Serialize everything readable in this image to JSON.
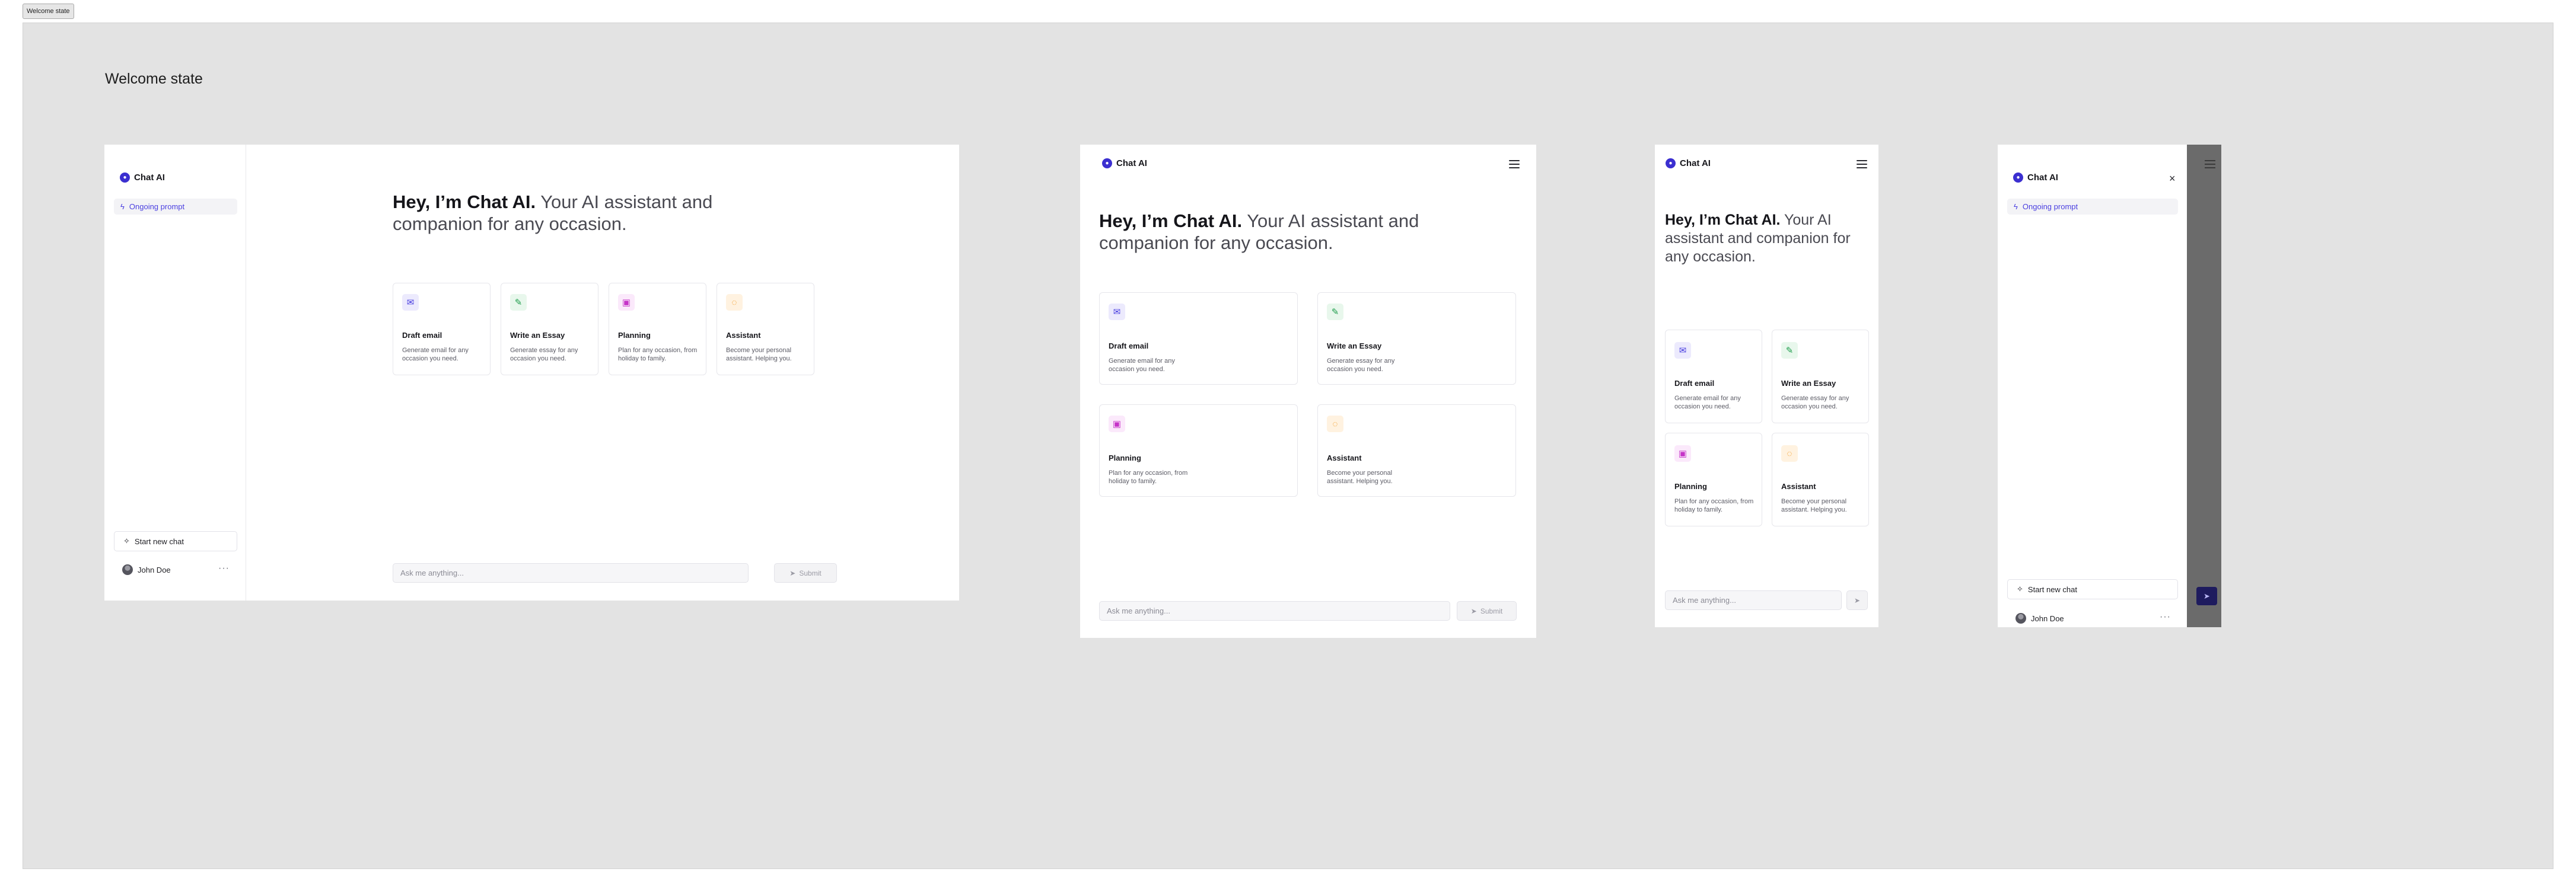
{
  "tag_label": "Welcome state",
  "section_title": "Welcome state",
  "app": {
    "brand": "Chat AI",
    "brand_icon": "chat-bubble-icon",
    "prompt_item": "Ongoing prompt",
    "new_chat": "Start new chat",
    "user_name": "John Doe",
    "more": "···"
  },
  "hero": {
    "bold": "Hey, I’m Chat AI.",
    "rest": " Your AI assistant and companion for any occasion."
  },
  "cards": [
    {
      "icon": "envelope-icon",
      "title": "Draft email",
      "desc": "Generate email for any occasion you need."
    },
    {
      "icon": "pencil-icon",
      "title": "Write an Essay",
      "desc": "Generate essay for any occasion you need."
    },
    {
      "icon": "calendar-icon",
      "title": "Planning",
      "desc": "Plan for any occasion, from holiday to family."
    },
    {
      "icon": "chat-icon",
      "title": "Assistant",
      "desc": "Become your personal assistant. Helping you."
    }
  ],
  "composer": {
    "placeholder": "Ask me anything...",
    "submit": "Submit"
  },
  "colors": {
    "accent": "#4a3fe0",
    "email": "#4a3fe0",
    "essay": "#1f9d4c",
    "planning": "#c634c8",
    "assistant": "#f08c00"
  }
}
